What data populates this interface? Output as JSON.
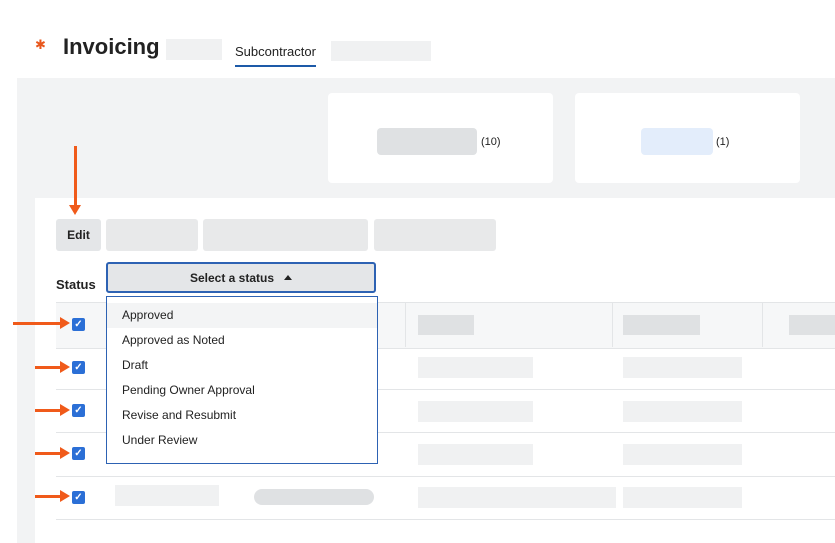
{
  "header": {
    "title": "Invoicing",
    "active_tab": "Subcontractor",
    "icon": "gear-icon"
  },
  "summary": {
    "card1_count": "(10)",
    "card2_count": "(1)"
  },
  "toolbar": {
    "edit_label": "Edit"
  },
  "filter": {
    "label": "Status",
    "placeholder": "Select a status",
    "options": [
      "Approved",
      "Approved as Noted",
      "Draft",
      "Pending Owner Approval",
      "Revise and Resubmit",
      "Under Review"
    ]
  },
  "colors": {
    "accent": "#2d62b3",
    "checkbox": "#2b6fd6",
    "annotation_arrow": "#f05a1a",
    "brand_icon": "#e8571c"
  }
}
